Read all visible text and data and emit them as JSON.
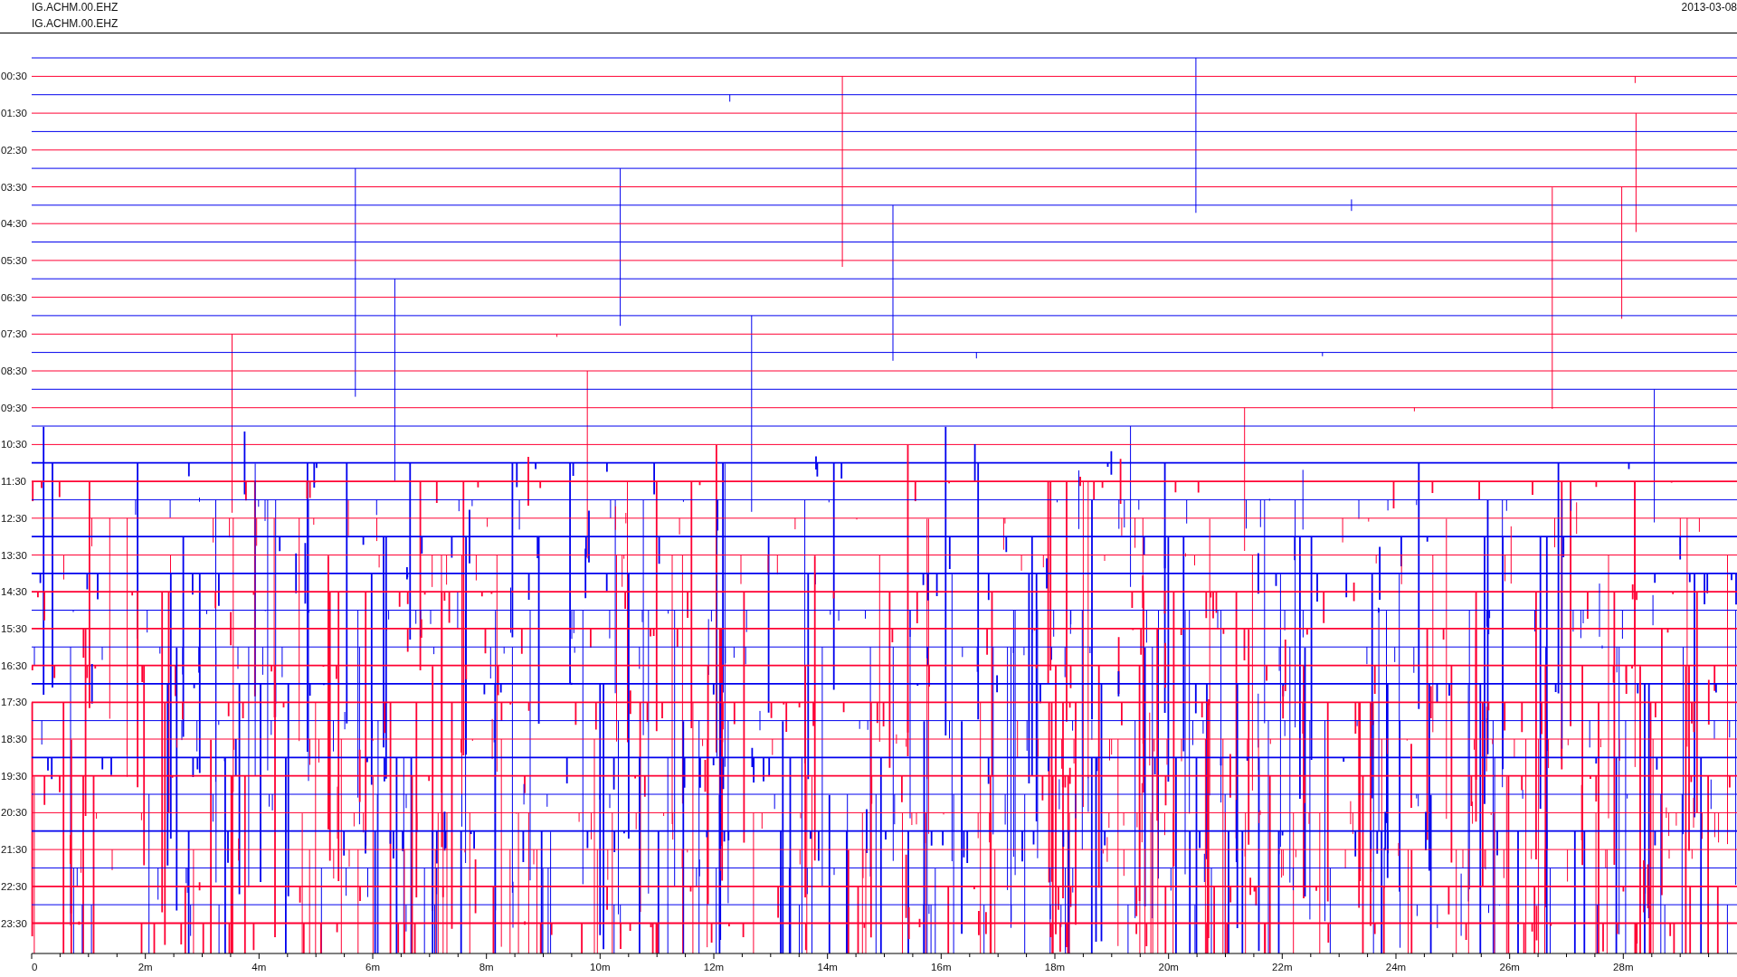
{
  "header": {
    "station_lines": [
      "IG.ACHM.00.EHZ",
      "IG.ACHM.00.EHZ"
    ],
    "date": "2013-03-08"
  },
  "plot": {
    "y_labels": [
      "00:30",
      "01:30",
      "02:30",
      "03:30",
      "04:30",
      "05:30",
      "06:30",
      "07:30",
      "08:30",
      "09:30",
      "10:30",
      "11:30",
      "12:30",
      "13:30",
      "14:30",
      "15:30",
      "16:30",
      "17:30",
      "18:30",
      "19:30",
      "20:30",
      "21:30",
      "22:30",
      "23:30"
    ],
    "x_ticks": [
      "0",
      "2m",
      "4m",
      "6m",
      "8m",
      "10m",
      "12m",
      "14m",
      "16m",
      "18m",
      "20m",
      "22m",
      "24m",
      "26m",
      "28m"
    ]
  }
}
